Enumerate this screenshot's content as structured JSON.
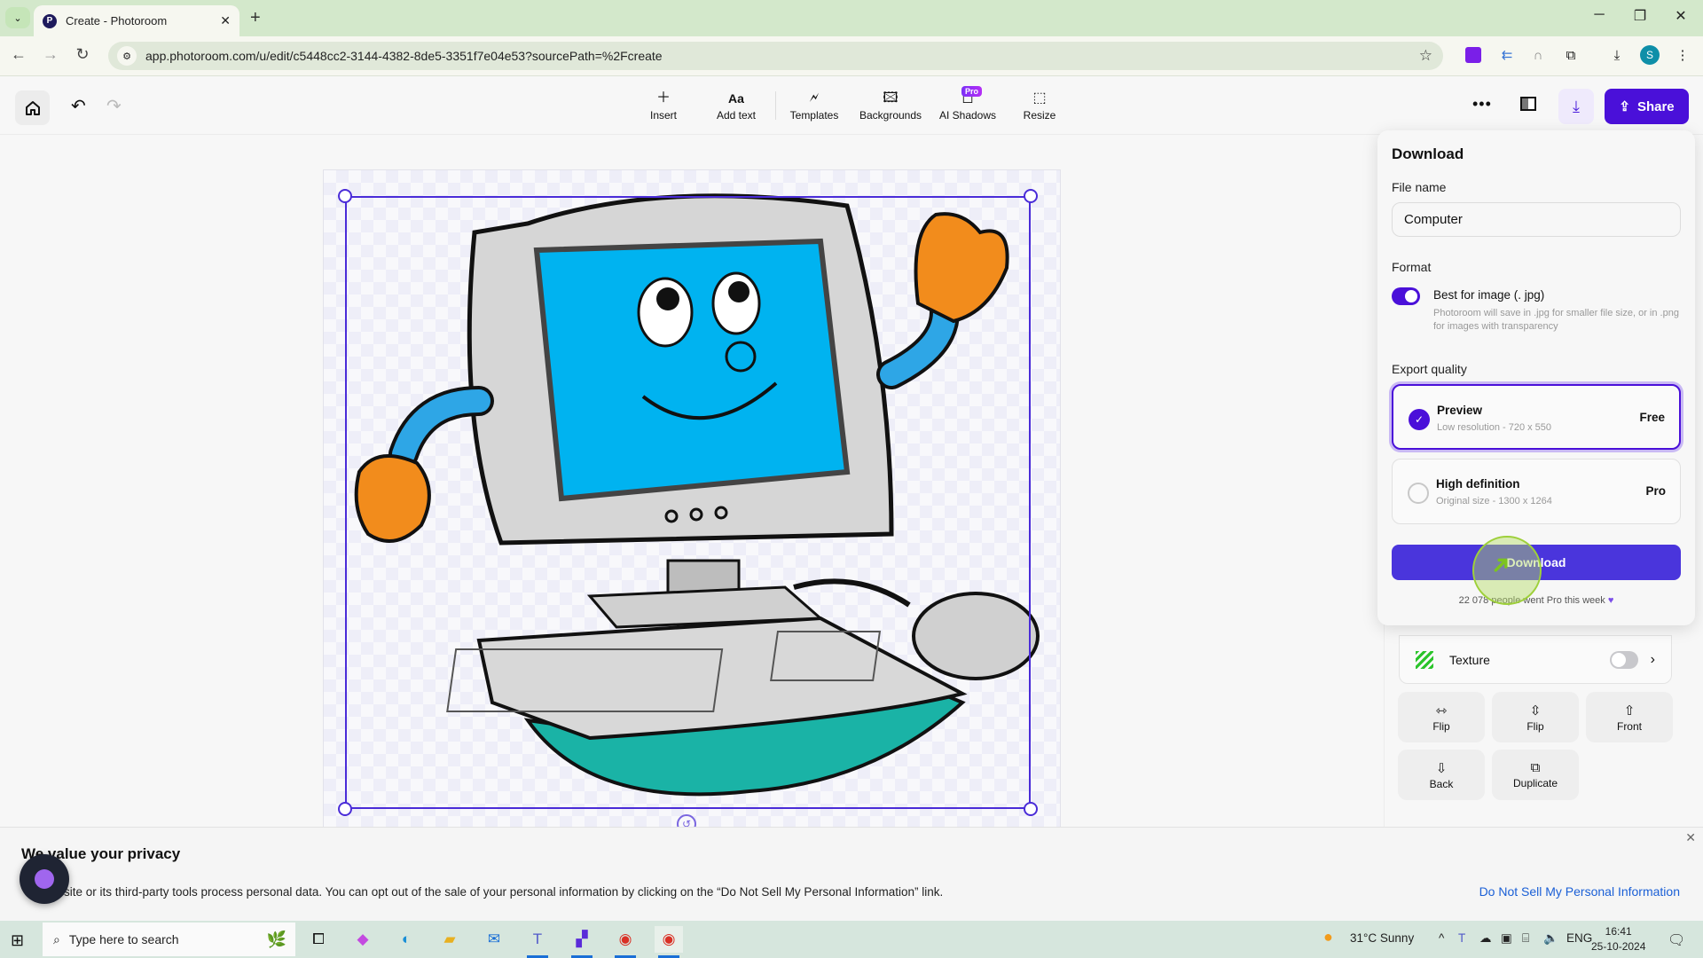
{
  "browser": {
    "tab_title": "Create - Photoroom",
    "tab_favicon": "P",
    "url": "app.photoroom.com/u/edit/c5448cc2-3144-4382-8de5-3351f7e04e53?sourcePath=%2Fcreate",
    "profile_initial": "S"
  },
  "app": {
    "toolbar": [
      {
        "label": "Insert",
        "icon": "plus-icon"
      },
      {
        "label": "Add text",
        "icon": "text-icon",
        "glyph": "Aa"
      },
      {
        "label": "Templates",
        "icon": "templates-icon"
      },
      {
        "label": "Backgrounds",
        "icon": "backgrounds-icon"
      },
      {
        "label": "AI Shadows",
        "icon": "ai-shadows-icon",
        "badge": "Pro"
      },
      {
        "label": "Resize",
        "icon": "resize-icon"
      }
    ],
    "share_label": "Share",
    "more_label": "•••"
  },
  "download_panel": {
    "title": "Download",
    "file_name_label": "File name",
    "file_name_value": "Computer",
    "format_label": "Format",
    "format_option": "Best for image (. jpg)",
    "format_enabled": true,
    "format_description": "Photoroom will save in .jpg for smaller file size, or in .png for images with transparency",
    "export_quality_label": "Export quality",
    "quality_options": [
      {
        "name": "Preview",
        "detail": "Low resolution - 720 x 550",
        "price": "Free",
        "selected": true
      },
      {
        "name": "High definition",
        "detail": "Original size - 1300 x 1264",
        "price": "Pro",
        "selected": false
      }
    ],
    "download_button": "Download",
    "promo_text": "22 078 people went Pro this week",
    "promo_icon": "purple-heart"
  },
  "properties_panel": {
    "texture_label": "Texture",
    "texture_enabled": false,
    "actions": [
      {
        "label": "Flip",
        "icon": "flip-horizontal-icon"
      },
      {
        "label": "Flip",
        "icon": "flip-vertical-icon"
      },
      {
        "label": "Front",
        "icon": "bring-front-icon"
      },
      {
        "label": "Back",
        "icon": "send-back-icon"
      },
      {
        "label": "Duplicate",
        "icon": "duplicate-icon"
      }
    ]
  },
  "canvas": {
    "subject": "cartoon computer character waving"
  },
  "privacy_banner": {
    "title": "We value your privacy",
    "text": "site or its third-party tools process personal data. You can opt out of the sale of your personal information by clicking on the “Do Not Sell My Personal Information” link.",
    "link": "Do Not Sell My Personal Information"
  },
  "taskbar": {
    "search_placeholder": "Type here to search",
    "weather": "31°C  Sunny",
    "language": "ENG",
    "time": "16:41",
    "date": "25-10-2024"
  }
}
